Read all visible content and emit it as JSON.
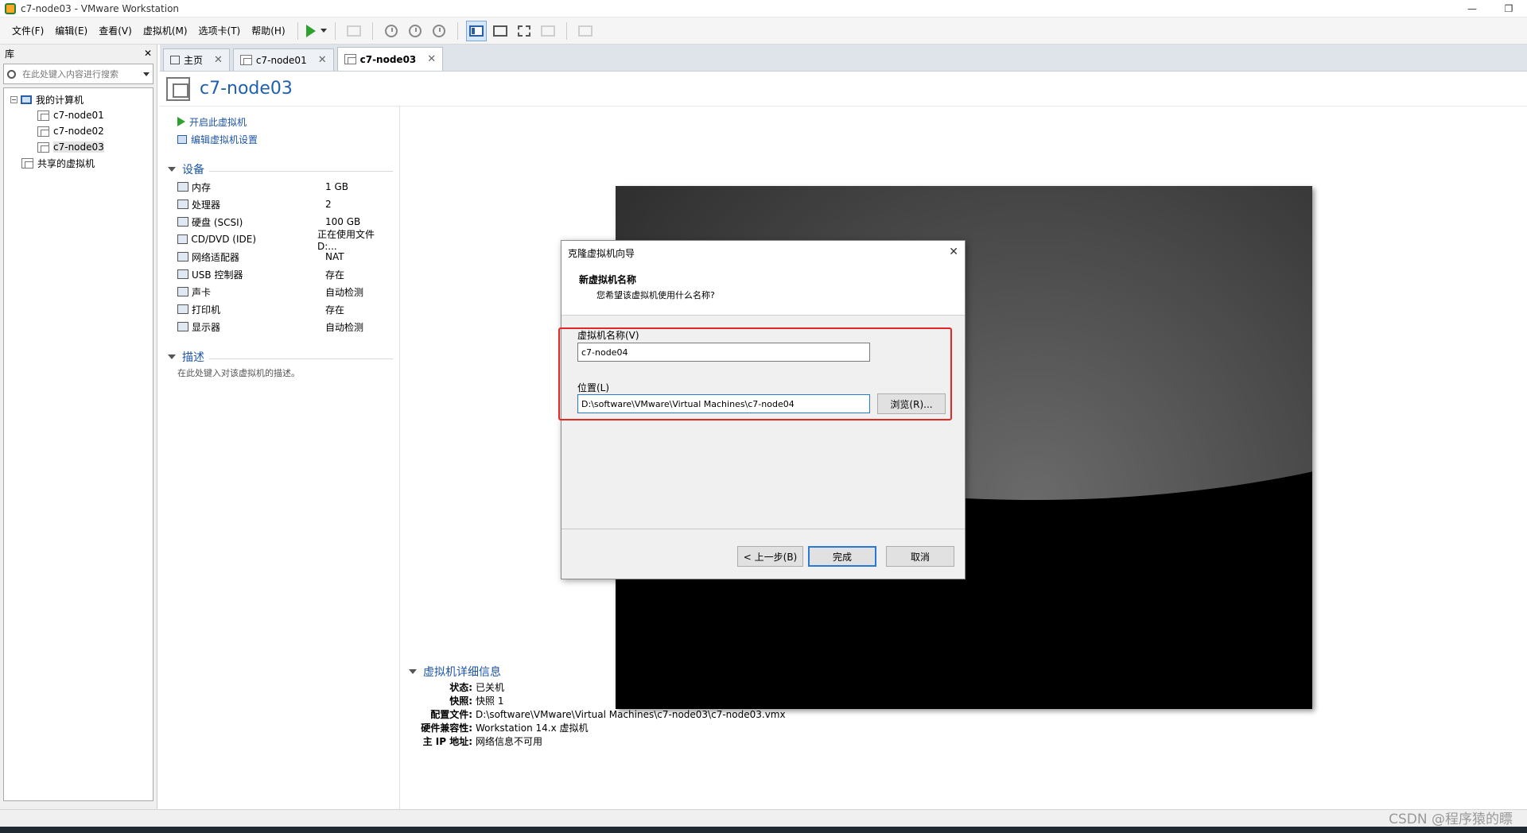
{
  "window": {
    "title": "c7-node03 - VMware Workstation",
    "min": "—",
    "restore": "❐",
    "close": "✕"
  },
  "menu": [
    "文件(F)",
    "编辑(E)",
    "查看(V)",
    "虚拟机(M)",
    "选项卡(T)",
    "帮助(H)"
  ],
  "library": {
    "title": "库",
    "close": "✕",
    "search_placeholder": "在此处键入内容进行搜索",
    "root": "我的计算机",
    "vms": [
      "c7-node01",
      "c7-node02",
      "c7-node03"
    ],
    "shared": "共享的虚拟机"
  },
  "tabs": [
    {
      "label": "主页",
      "close": "✕"
    },
    {
      "label": "c7-node01",
      "close": "✕"
    },
    {
      "label": "c7-node03",
      "close": "✕"
    }
  ],
  "vm": {
    "name": "c7-node03",
    "actions": {
      "power_on": "开启此虚拟机",
      "edit": "编辑虚拟机设置"
    },
    "devices_title": "设备",
    "devices": [
      {
        "name": "内存",
        "value": "1 GB"
      },
      {
        "name": "处理器",
        "value": "2"
      },
      {
        "name": "硬盘 (SCSI)",
        "value": "100 GB"
      },
      {
        "name": "CD/DVD (IDE)",
        "value": "正在使用文件 D:..."
      },
      {
        "name": "网络适配器",
        "value": "NAT"
      },
      {
        "name": "USB 控制器",
        "value": "存在"
      },
      {
        "name": "声卡",
        "value": "自动检测"
      },
      {
        "name": "打印机",
        "value": "存在"
      },
      {
        "name": "显示器",
        "value": "自动检测"
      }
    ],
    "desc_title": "描述",
    "desc_placeholder": "在此处键入对该虚拟机的描述。",
    "details_title": "虚拟机详细信息",
    "details": [
      {
        "k": "状态:",
        "v": "已关机"
      },
      {
        "k": "快照:",
        "v": "快照 1"
      },
      {
        "k": "配置文件:",
        "v": "D:\\software\\VMware\\Virtual Machines\\c7-node03\\c7-node03.vmx"
      },
      {
        "k": "硬件兼容性:",
        "v": "Workstation 14.x 虚拟机"
      },
      {
        "k": "主 IP 地址:",
        "v": "网络信息不可用"
      }
    ]
  },
  "dialog": {
    "title": "克隆虚拟机向导",
    "close": "✕",
    "heading": "新虚拟机名称",
    "subheading": "您希望该虚拟机使用什么名称?",
    "name_label": "虚拟机名称(V)",
    "name_value": "c7-node04",
    "location_label": "位置(L)",
    "location_value": "D:\\software\\VMware\\Virtual Machines\\c7-node04",
    "browse": "浏览(R)...",
    "back": "< 上一步(B)",
    "finish": "完成",
    "cancel": "取消"
  },
  "watermark": "CSDN @程序猿的瞟"
}
